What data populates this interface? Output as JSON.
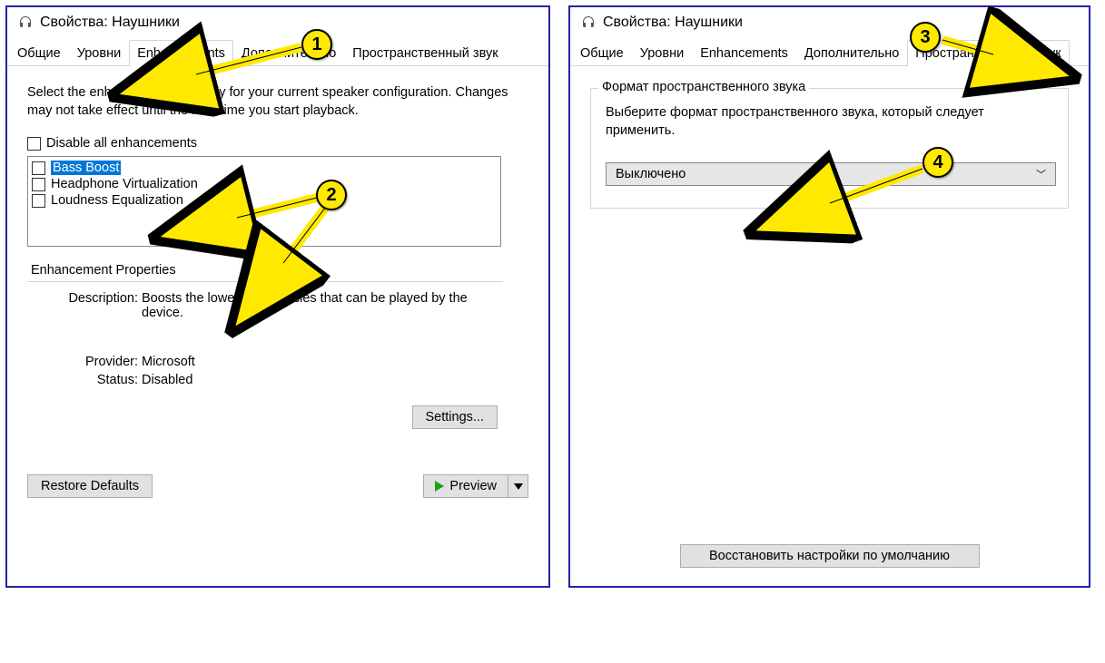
{
  "left": {
    "title": "Свойства: Наушники",
    "tabs": [
      "Общие",
      "Уровни",
      "Enhancements",
      "Дополнительно",
      "Пространственный звук"
    ],
    "active_tab": 2,
    "instruction": "Select the enhancements to apply for your current speaker configuration. Changes may not take effect until the next time you start playback.",
    "disable_all": "Disable all enhancements",
    "items": [
      {
        "label": "Bass Boost",
        "selected": true
      },
      {
        "label": "Headphone Virtualization",
        "selected": false
      },
      {
        "label": "Loudness Equalization",
        "selected": false
      }
    ],
    "props_title": "Enhancement Properties",
    "props": {
      "desc_k": "Description:",
      "desc_v": "Boosts the lowest frequencies that can be played by the device.",
      "provider_k": "Provider:",
      "provider_v": "Microsoft",
      "status_k": "Status:",
      "status_v": "Disabled"
    },
    "settings_btn": "Settings...",
    "restore_btn": "Restore Defaults",
    "preview_btn": "Preview"
  },
  "right": {
    "title": "Свойства: Наушники",
    "tabs": [
      "Общие",
      "Уровни",
      "Enhancements",
      "Дополнительно",
      "Пространственный звук"
    ],
    "active_tab": 4,
    "group_title": "Формат пространственного звука",
    "group_text": "Выберите формат пространственного звука, который следует применить.",
    "combo_value": "Выключено",
    "restore_btn": "Восстановить настройки по умолчанию"
  },
  "callouts": {
    "c1": "1",
    "c2": "2",
    "c3": "3",
    "c4": "4"
  }
}
